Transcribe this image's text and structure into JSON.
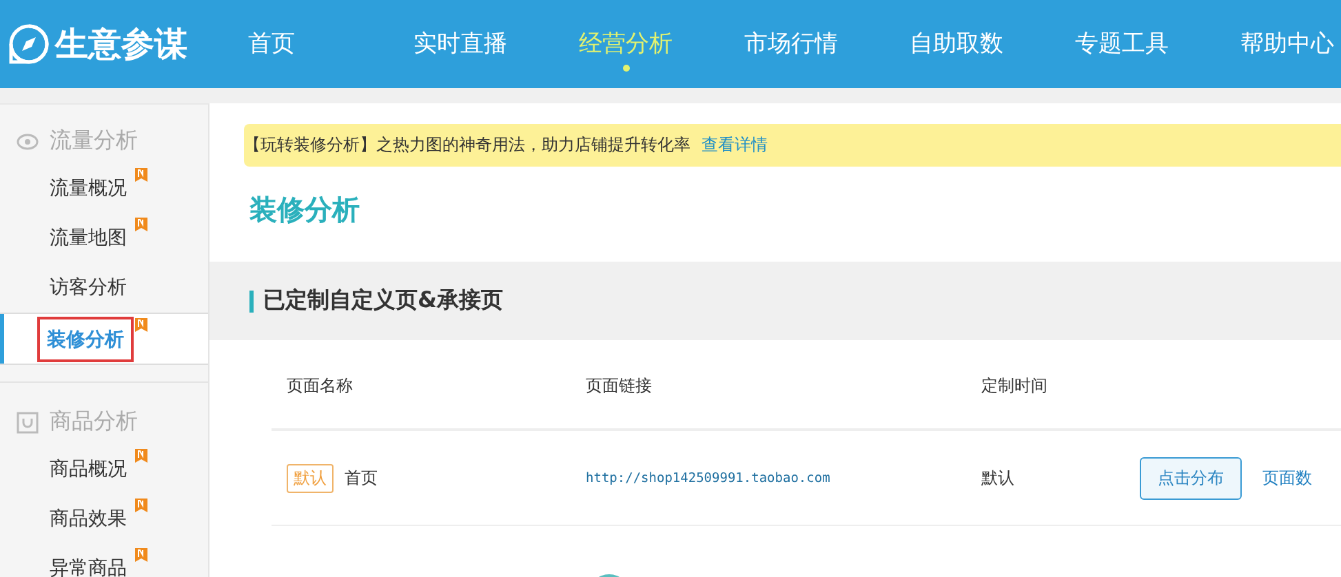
{
  "header": {
    "logo": "生意参谋",
    "nav": [
      {
        "label": "首页",
        "selected": false
      },
      {
        "label": "实时直播",
        "selected": false
      },
      {
        "label": "经营分析",
        "selected": true
      },
      {
        "label": "市场行情",
        "selected": false
      },
      {
        "label": "自助取数",
        "selected": false
      },
      {
        "label": "专题工具",
        "selected": false
      },
      {
        "label": "帮助中心",
        "selected": false
      }
    ]
  },
  "sidebar": {
    "groups": [
      {
        "title": "流量分析",
        "kind": "traffic",
        "items": [
          {
            "label": "流量概况",
            "new": true,
            "selected": false
          },
          {
            "label": "流量地图",
            "new": true,
            "selected": false
          },
          {
            "label": "访客分析",
            "new": false,
            "selected": false
          },
          {
            "label": "装修分析",
            "new": true,
            "selected": true
          }
        ]
      },
      {
        "title": "商品分析",
        "kind": "goods",
        "items": [
          {
            "label": "商品概况",
            "new": true,
            "selected": false
          },
          {
            "label": "商品效果",
            "new": true,
            "selected": false
          },
          {
            "label": "异常商品",
            "new": true,
            "selected": false
          }
        ]
      }
    ]
  },
  "notice": {
    "text": "【玩转装修分析】之热力图的神奇用法，助力店铺提升转化率",
    "link": "查看详情"
  },
  "page_title": "装修分析",
  "section_title": "已定制自定义页&承接页",
  "table": {
    "columns": [
      "页面名称",
      "页面链接",
      "定制时间"
    ],
    "rows": [
      {
        "tag": "默认",
        "name": "首页",
        "url": "http://shop142509991.taobao.com",
        "time": "默认",
        "button": "点击分布",
        "link": "页面数"
      }
    ]
  }
}
